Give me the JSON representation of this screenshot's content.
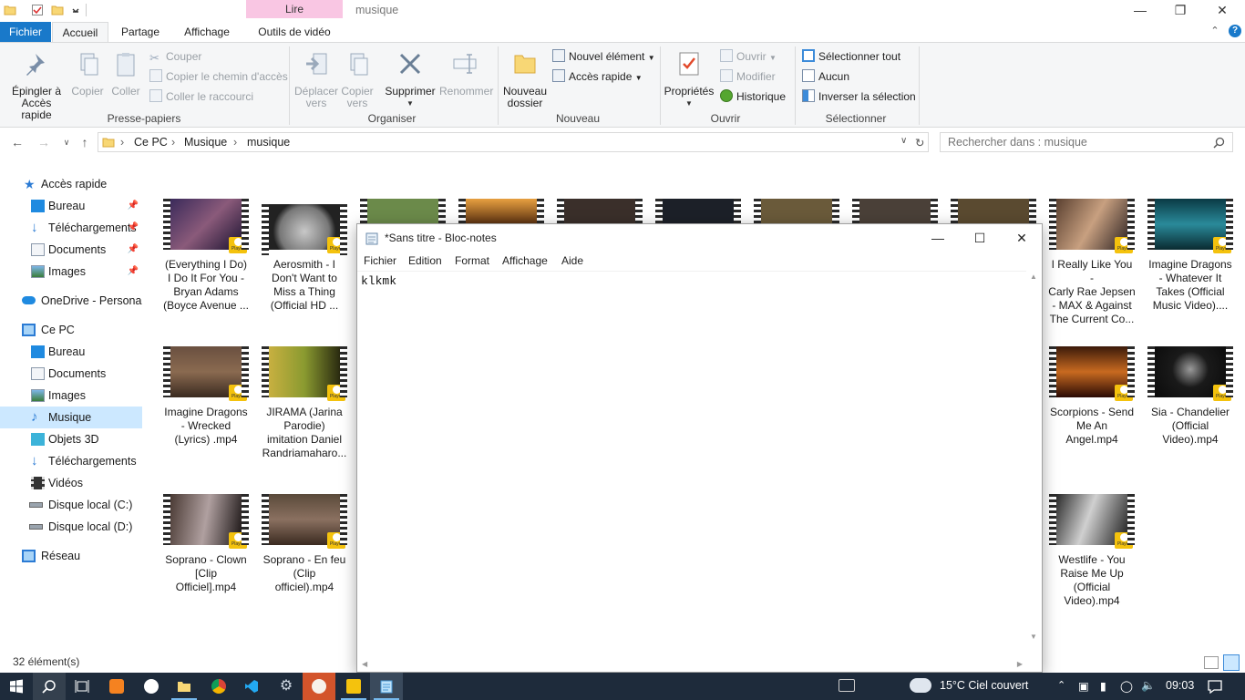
{
  "window": {
    "title": "musique",
    "context_tab": "Lire"
  },
  "ribbon_tabs": [
    "Fichier",
    "Accueil",
    "Partage",
    "Affichage",
    "Outils de vidéo"
  ],
  "ribbon": {
    "presse_papiers": {
      "label": "Presse-papiers",
      "pin": "Épingler à\nAccès rapide",
      "pin_l1": "Épingler à",
      "pin_l2": "Accès rapide",
      "copy": "Copier",
      "paste": "Coller",
      "cut": "Couper",
      "copy_path": "Copier le chemin d'accès",
      "paste_shortcut": "Coller le raccourci"
    },
    "organiser": {
      "label": "Organiser",
      "move_l1": "Déplacer",
      "move_l2": "vers",
      "copyto_l1": "Copier",
      "copyto_l2": "vers",
      "delete": "Supprimer",
      "rename": "Renommer"
    },
    "nouveau": {
      "label": "Nouveau",
      "newfolder_l1": "Nouveau",
      "newfolder_l2": "dossier",
      "new_item": "Nouvel élément",
      "quick_access": "Accès rapide"
    },
    "ouvrir": {
      "label": "Ouvrir",
      "properties": "Propriétés",
      "open": "Ouvrir",
      "edit": "Modifier",
      "history": "Historique"
    },
    "selectionner": {
      "label": "Sélectionner",
      "select_all": "Sélectionner tout",
      "none": "Aucun",
      "invert": "Inverser la sélection"
    }
  },
  "address": {
    "crumbs": [
      "Ce PC",
      "Musique",
      "musique"
    ],
    "search_placeholder": "Rechercher dans : musique"
  },
  "nav": {
    "quick_access": "Accès rapide",
    "items_quick": [
      "Bureau",
      "Téléchargements",
      "Documents",
      "Images"
    ],
    "onedrive": "OneDrive - Personal",
    "this_pc": "Ce PC",
    "items_pc": [
      "Bureau",
      "Documents",
      "Images",
      "Musique",
      "Objets 3D",
      "Téléchargements",
      "Vidéos",
      "Disque local (C:)",
      "Disque local (D:)"
    ],
    "network": "Réseau"
  },
  "files": [
    {
      "l1": "(Everything I Do)",
      "l2": "I Do It For You -",
      "l3": "Bryan Adams",
      "l4": "(Boyce Avenue ..."
    },
    {
      "l1": "Aerosmith - I",
      "l2": "Don't Want to",
      "l3": "Miss a Thing",
      "l4": "(Official HD ..."
    },
    {
      "l1": "I Really Like You -",
      "l2": "Carly Rae Jepsen",
      "l3": "- MAX & Against",
      "l4": "The Current Co..."
    },
    {
      "l1": "Imagine Dragons",
      "l2": "- Whatever It",
      "l3": "Takes (Official",
      "l4": "Music Video)...."
    },
    {
      "l1": "Imagine Dragons",
      "l2": "- Wrecked",
      "l3": "(Lyrics) .mp4",
      "l4": ""
    },
    {
      "l1": "JIRAMA (Jarina",
      "l2": "Parodie)",
      "l3": "imitation Daniel",
      "l4": "Randriamaharo..."
    },
    {
      "l1": "Scorpions - Send",
      "l2": "Me An",
      "l3": "Angel.mp4",
      "l4": ""
    },
    {
      "l1": "Sia - Chandelier",
      "l2": "(Official",
      "l3": "Video).mp4",
      "l4": ""
    },
    {
      "l1": "Soprano - Clown",
      "l2": "[Clip",
      "l3": "Officiel].mp4",
      "l4": ""
    },
    {
      "l1": "Soprano - En feu",
      "l2": "(Clip",
      "l3": "officiel).mp4",
      "l4": ""
    },
    {
      "l1": "Westlife - You",
      "l2": "Raise Me Up",
      "l3": "(Official",
      "l4": "Video).mp4"
    }
  ],
  "badge_text": "Player",
  "status": {
    "count": "32 élément(s)"
  },
  "notepad": {
    "title": "*Sans titre - Bloc-notes",
    "menu": [
      "Fichier",
      "Edition",
      "Format",
      "Affichage",
      "Aide"
    ],
    "content": "klkmk"
  },
  "taskbar": {
    "weather": "15°C  Ciel couvert",
    "time": "09:03"
  },
  "colors": {
    "accent": "#1979ca",
    "selection": "#cce8ff",
    "taskbar": "#1e2b3b",
    "context_tab": "#f9c6e3",
    "badge": "#f4c20d"
  }
}
